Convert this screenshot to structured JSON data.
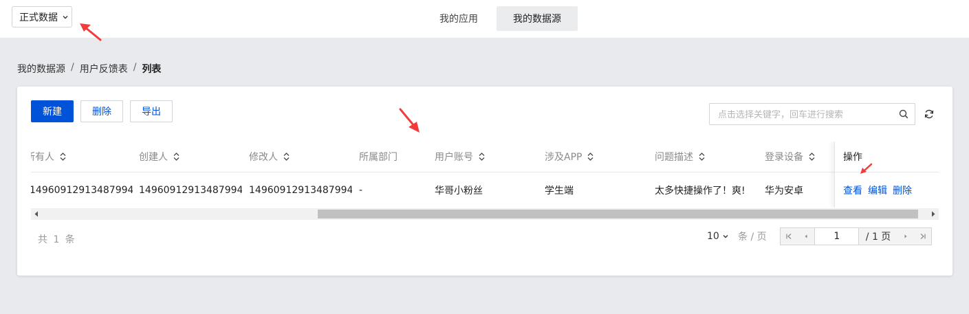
{
  "topbar": {
    "env_select": "正式数据",
    "tabs": [
      {
        "label": "我的应用",
        "active": false
      },
      {
        "label": "我的数据源",
        "active": true
      }
    ]
  },
  "breadcrumb": {
    "items": [
      "我的数据源",
      "用户反馈表"
    ],
    "separator": "/",
    "current": "列表"
  },
  "toolbar": {
    "new_label": "新建",
    "delete_label": "删除",
    "export_label": "导出",
    "search_placeholder": "点击选择关键字，回车进行搜索",
    "refresh_icon": "refresh-icon"
  },
  "table": {
    "columns": [
      "所有人",
      "创建人",
      "修改人",
      "所属部门",
      "用户账号",
      "涉及APP",
      "问题描述",
      "登录设备"
    ],
    "sortable": [
      true,
      true,
      true,
      false,
      true,
      true,
      true,
      true
    ],
    "rows": [
      {
        "cells": [
          "14960912913487994...",
          "14960912913487994...",
          "14960912913487994...",
          "-",
          "华哥小粉丝",
          "学生端",
          "太多快捷操作了！爽!",
          "华为安卓"
        ]
      }
    ],
    "actions_header": "操作",
    "actions": [
      "查看",
      "编辑",
      "删除"
    ]
  },
  "footer": {
    "total_text": "共 1 条",
    "page_size": "10",
    "per_page_label": "条 / 页",
    "current_page": "1",
    "total_pages_text": "/ 1 页"
  },
  "colors": {
    "primary": "#0052d9",
    "page_bg": "#e8eaed",
    "annotation_arrow": "#f03c3c"
  }
}
